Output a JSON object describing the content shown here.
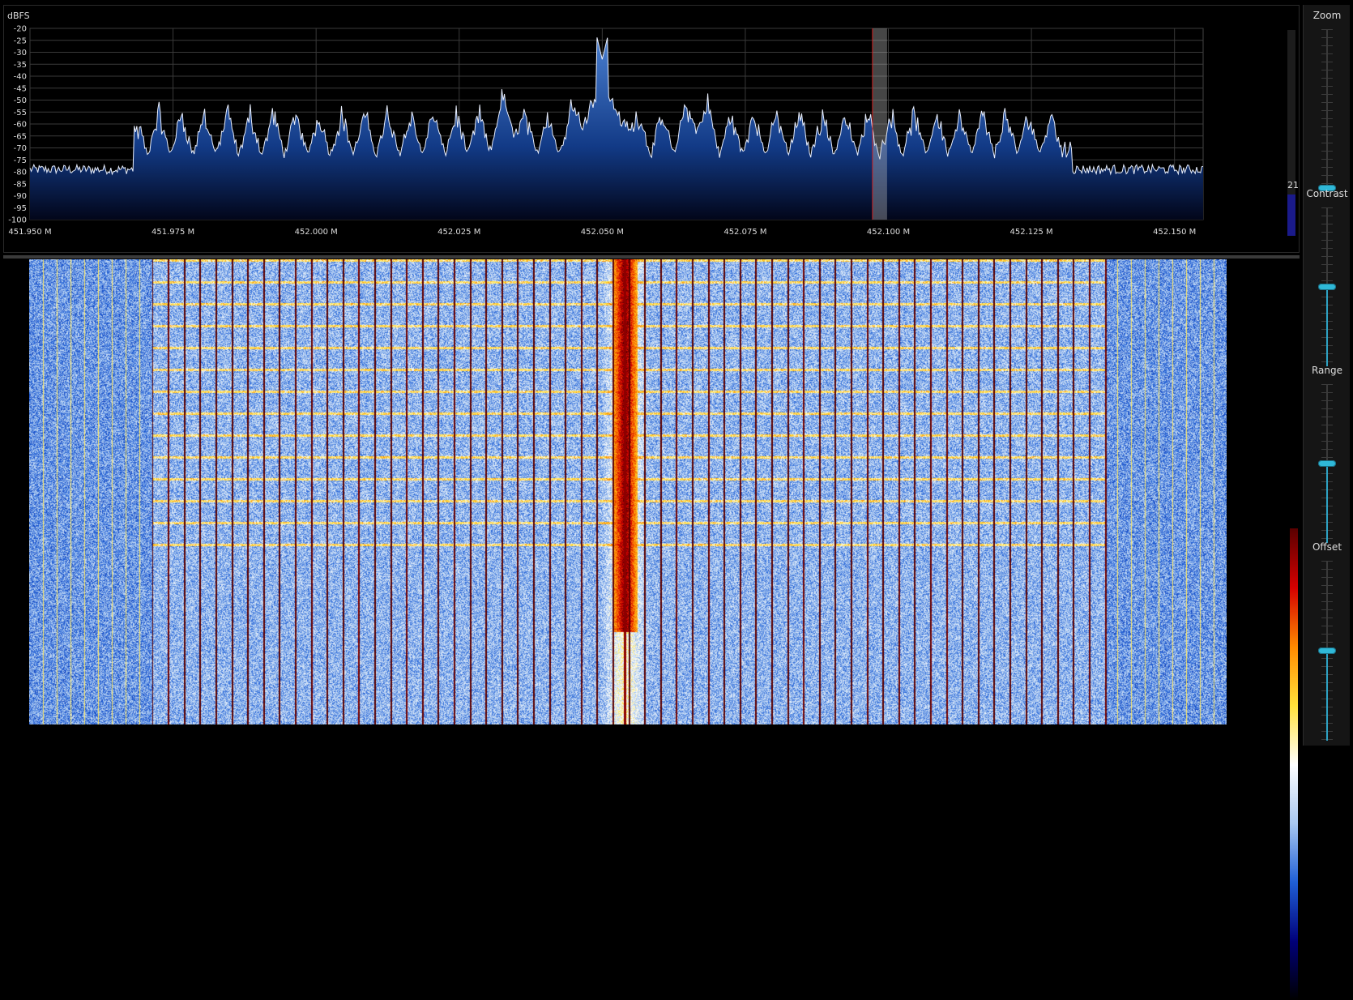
{
  "window": {},
  "spectrum": {
    "unit_label": "dBFS",
    "y_ticks": [
      "-20",
      "-25",
      "-30",
      "-35",
      "-40",
      "-45",
      "-50",
      "-55",
      "-60",
      "-65",
      "-70",
      "-75",
      "-80",
      "-85",
      "-90",
      "-95",
      "-100"
    ],
    "y_range_dbfs": [
      -100,
      -20
    ],
    "x_ticks": [
      "451.950 M",
      "451.975 M",
      "452.000 M",
      "452.025 M",
      "452.050 M",
      "452.075 M",
      "452.100 M",
      "452.125 M",
      "452.150 M"
    ],
    "x_range_mhz": [
      451.95,
      452.155
    ],
    "center_frequency_mhz": 452.05,
    "noise_floor_dbfs": -79,
    "center_peak_dbfs": -33,
    "marker_frequency_mhz": 452.0985,
    "level_readout": "21",
    "level_fraction": 0.2
  },
  "waterfall": {
    "colormap": [
      "#000000",
      "#00007a",
      "#1f5fd6",
      "#a9c8f0",
      "#ffffff",
      "#ffe23b",
      "#ff8a00",
      "#d60000",
      "#5a0000"
    ]
  },
  "controls": {
    "zoom": {
      "label": "Zoom",
      "value_fraction": 0.0
    },
    "contrast": {
      "label": "Contrast",
      "value_fraction": 0.5
    },
    "range": {
      "label": "Range",
      "value_fraction": 0.5
    },
    "offset": {
      "label": "Offset",
      "value_fraction": 0.5
    }
  },
  "colors": {
    "trace": "#e8eefc",
    "fill_top": "#4a7fd0",
    "fill_bottom": "#02061a",
    "grid": "#3a3a3a",
    "marker": "#c8c8c8",
    "marker_line": "#d02020",
    "accent": "#2fb8d8"
  }
}
